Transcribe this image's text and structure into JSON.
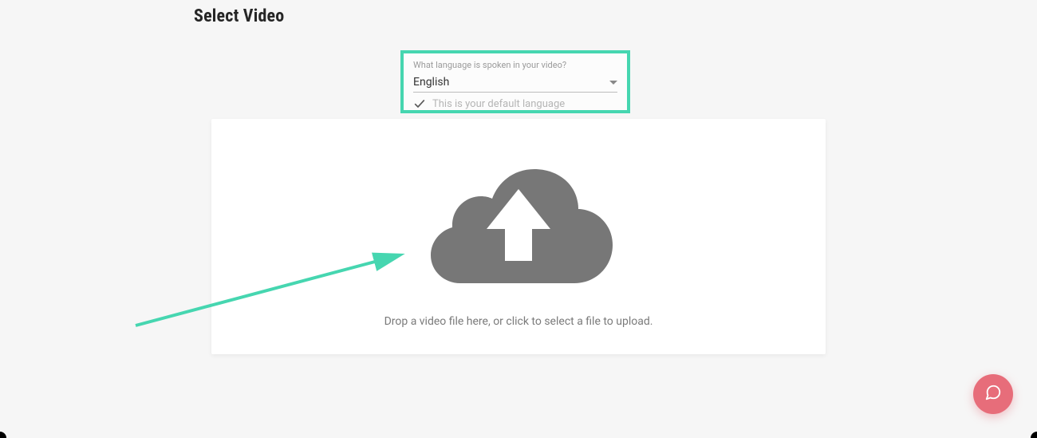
{
  "title": "Select Video",
  "language_panel": {
    "label": "What language is spoken in your video?",
    "selected": "English",
    "default_note": "This is your default language"
  },
  "dropzone": {
    "instruction": "Drop a video file here, or click to select a file to upload."
  }
}
